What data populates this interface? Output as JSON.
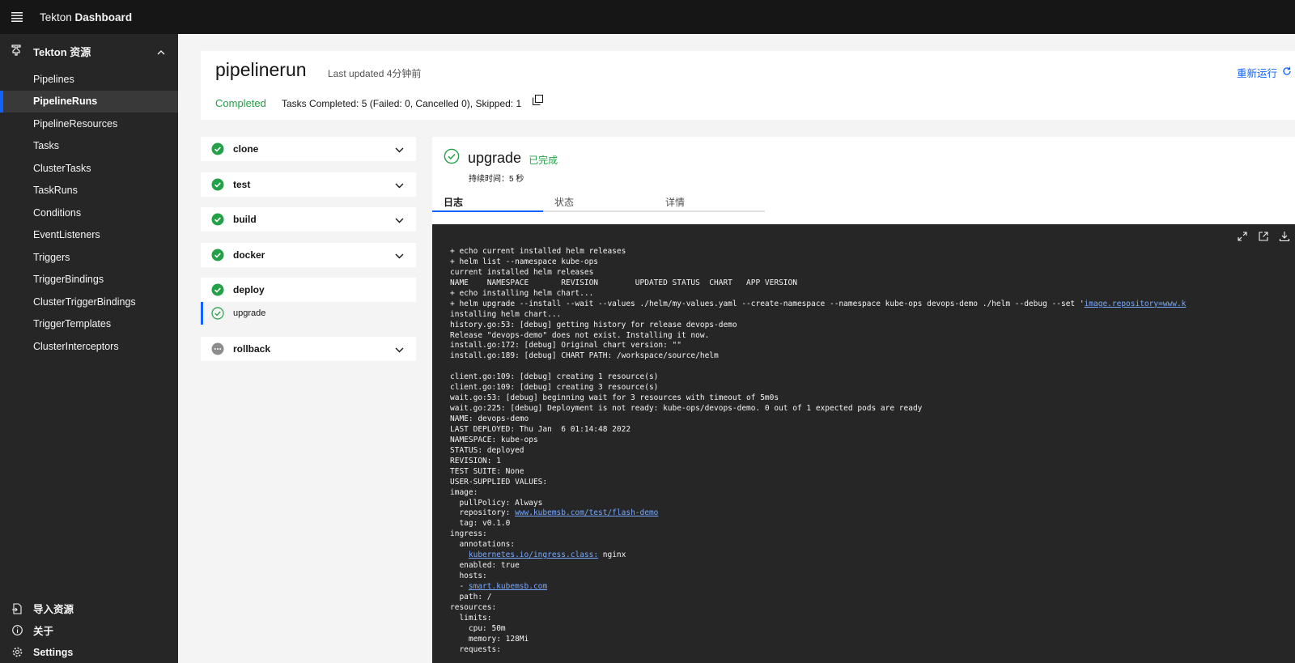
{
  "app": {
    "name_prefix": "Tekton",
    "name_bold": "Dashboard"
  },
  "sidebar": {
    "section_title": "Tekton 资源",
    "items": [
      {
        "label": "Pipelines",
        "active": false
      },
      {
        "label": "PipelineRuns",
        "active": true
      },
      {
        "label": "PipelineResources",
        "active": false
      },
      {
        "label": "Tasks",
        "active": false
      },
      {
        "label": "ClusterTasks",
        "active": false
      },
      {
        "label": "TaskRuns",
        "active": false
      },
      {
        "label": "Conditions",
        "active": false
      },
      {
        "label": "EventListeners",
        "active": false
      },
      {
        "label": "Triggers",
        "active": false
      },
      {
        "label": "TriggerBindings",
        "active": false
      },
      {
        "label": "ClusterTriggerBindings",
        "active": false
      },
      {
        "label": "TriggerTemplates",
        "active": false
      },
      {
        "label": "ClusterInterceptors",
        "active": false
      }
    ],
    "bottom": {
      "import": "导入资源",
      "about": "关于",
      "settings": "Settings"
    }
  },
  "pipelinerun": {
    "title": "pipelinerun",
    "last_updated": "Last updated 4分钟前",
    "status": "Completed",
    "tasks_summary": "Tasks Completed: 5 (Failed: 0, Cancelled 0), Skipped: 1",
    "rerun": "重新运行"
  },
  "tasks": [
    {
      "name": "clone",
      "status": "success"
    },
    {
      "name": "test",
      "status": "success"
    },
    {
      "name": "build",
      "status": "success"
    },
    {
      "name": "docker",
      "status": "success"
    },
    {
      "name": "deploy",
      "status": "success",
      "steps": [
        {
          "name": "upgrade",
          "status": "success"
        }
      ]
    },
    {
      "name": "rollback",
      "status": "skipped"
    }
  ],
  "step_detail": {
    "name": "upgrade",
    "status_text": "已完成",
    "duration": "持续时间：5 秒",
    "tabs": [
      "日志",
      "状态",
      "详情"
    ]
  },
  "log": {
    "lines": [
      "+ echo current installed helm releases",
      "+ helm list --namespace kube-ops",
      "current installed helm releases",
      "NAME    NAMESPACE       REVISION        UPDATED STATUS  CHART   APP VERSION",
      "+ echo installing helm chart...",
      "+ helm upgrade --install --wait --values ./helm/my-values.yaml --create-namespace --namespace kube-ops devops-demo ./helm --debug --set 'image.repository=www.k",
      "installing helm chart...",
      "history.go:53: [debug] getting history for release devops-demo",
      "Release \"devops-demo\" does not exist. Installing it now.",
      "install.go:172: [debug] Original chart version: \"\"",
      "install.go:189: [debug] CHART PATH: /workspace/source/helm",
      "",
      "client.go:109: [debug] creating 1 resource(s)",
      "client.go:109: [debug] creating 3 resource(s)",
      "wait.go:53: [debug] beginning wait for 3 resources with timeout of 5m0s",
      "wait.go:225: [debug] Deployment is not ready: kube-ops/devops-demo. 0 out of 1 expected pods are ready",
      "NAME: devops-demo",
      "LAST DEPLOYED: Thu Jan  6 01:14:48 2022",
      "NAMESPACE: kube-ops",
      "STATUS: deployed",
      "REVISION: 1",
      "TEST SUITE: None",
      "USER-SUPPLIED VALUES:",
      "image:",
      "  pullPolicy: Always",
      "  repository: www.kubemsb.com/test/flash-demo",
      "  tag: v0.1.0",
      "ingress:",
      "  annotations:",
      "    kubernetes.io/ingress.class: nginx",
      "  enabled: true",
      "  hosts:",
      "  - smart.kubemsb.com",
      "  path: /",
      "resources:",
      "  limits:",
      "    cpu: 50m",
      "    memory: 128Mi",
      "  requests:"
    ],
    "links": [
      {
        "line": 5,
        "prefix": "+ helm upgrade --install --wait --values ./helm/my-values.yaml --create-namespace --namespace kube-ops devops-demo ./helm --debug --set '",
        "link": "image.repository=www.k",
        "suffix": ""
      },
      {
        "line": 25,
        "prefix": "  repository: ",
        "link": "www.kubemsb.com/test/flash-demo",
        "suffix": ""
      },
      {
        "line": 29,
        "prefix": "    ",
        "link": "kubernetes.io/ingress.class:",
        "suffix": " nginx"
      },
      {
        "line": 32,
        "prefix": "  - ",
        "link": "smart.kubemsb.com",
        "suffix": ""
      }
    ]
  },
  "colors": {
    "success": "#24a148",
    "skipped": "#8d8d8d",
    "accent": "#0f62fe",
    "link": "#78a9ff"
  }
}
